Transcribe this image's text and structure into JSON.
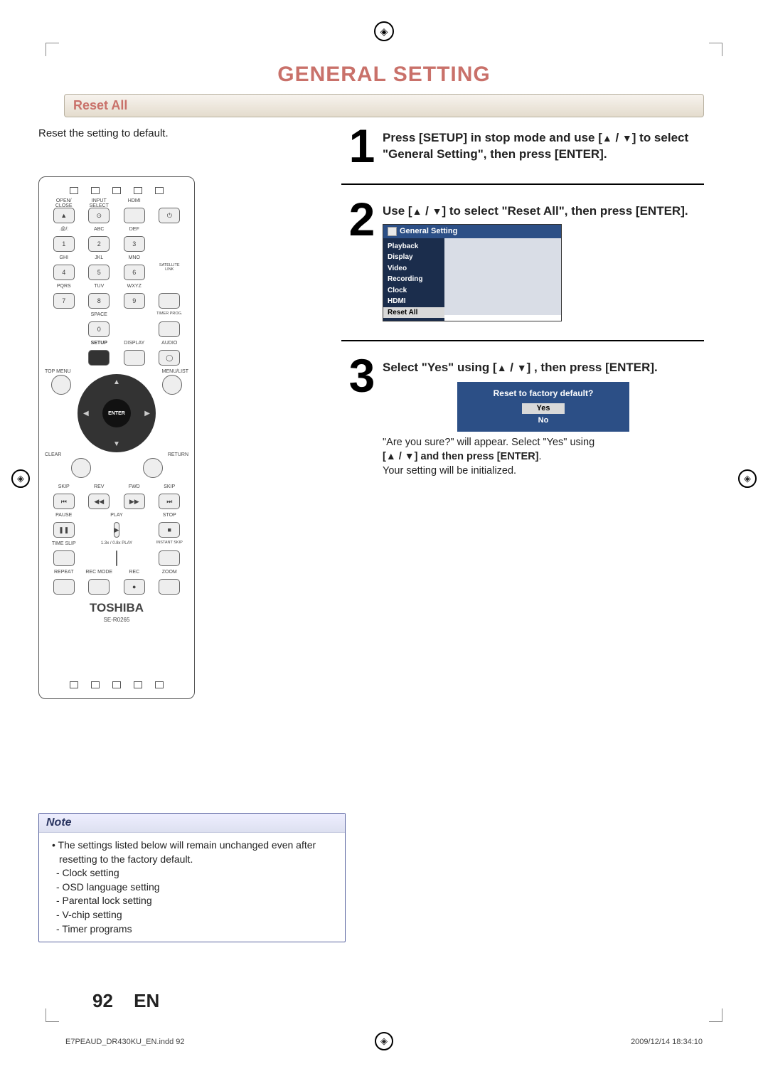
{
  "title": "GENERAL SETTING",
  "section_bar": "Reset All",
  "intro": "Reset the setting to default.",
  "steps": {
    "s1": {
      "num": "1",
      "text_a": "Press [SETUP] in stop mode and use [",
      "text_b": " / ",
      "text_c": "] to select \"General Setting\", then press [ENTER]."
    },
    "s2": {
      "num": "2",
      "text_a": "Use [",
      "text_b": " / ",
      "text_c": "] to select \"Reset All\", then press [ENTER].",
      "osd_title": "General Setting",
      "menu": [
        "Playback",
        "Display",
        "Video",
        "Recording",
        "Clock",
        "HDMI",
        "Reset All"
      ]
    },
    "s3": {
      "num": "3",
      "text_a": "Select \"Yes\" using [",
      "text_b": " / ",
      "text_c": "] , then press [ENTER].",
      "confirm_title": "Reset to factory default?",
      "yes": "Yes",
      "no": "No",
      "after_a": "\"Are you sure?\" will appear. Select \"Yes\" using",
      "after_b": "[",
      "after_c": " / ",
      "after_d": "] and then press ",
      "after_e": "[ENTER]",
      "after_f": ".",
      "after2": "Your setting will be initialized."
    }
  },
  "remote": {
    "row1": [
      "OPEN/\nCLOSE",
      "INPUT\nSELECT",
      "HDMI",
      ""
    ],
    "row2": [
      ".@/:",
      "ABC",
      "DEF",
      ""
    ],
    "nums": [
      "1",
      "2",
      "3",
      "4",
      "5",
      "6",
      "7",
      "8",
      "9",
      "",
      "0",
      ""
    ],
    "row2b": [
      "GHI",
      "JKL",
      "MNO",
      "",
      "PQRS",
      "TUV",
      "WXYZ",
      "SATELLITE\nLINK",
      "",
      "SPACE",
      "",
      "TIMER\nPROG."
    ],
    "row3": [
      "",
      "SETUP",
      "DISPLAY",
      "AUDIO"
    ],
    "top_menu": "TOP MENU",
    "menu_list": "MENU/LIST",
    "enter": "ENTER",
    "clear": "CLEAR",
    "return": "RETURN",
    "trans_labels": [
      "SKIP",
      "REV",
      "FWD",
      "SKIP",
      "PAUSE",
      "PLAY",
      "",
      "STOP",
      "TIME SLIP",
      "1.3x / 0.8x PLAY",
      "",
      "INSTANT SKIP",
      "REPEAT",
      "REC MODE",
      "REC",
      "ZOOM"
    ],
    "brand": "TOSHIBA",
    "model": "SE-R0265",
    "power": "⏻"
  },
  "note": {
    "title": "Note",
    "lead": "The settings listed below will remain unchanged even after resetting to the factory default.",
    "items": [
      "- Clock setting",
      "- OSD language setting",
      "- Parental lock setting",
      "- V-chip setting",
      "- Timer programs"
    ]
  },
  "footer": {
    "page": "92",
    "lang": "EN"
  },
  "fine": {
    "left": "E7PEAUD_DR430KU_EN.indd   92",
    "right": "2009/12/14   18:34:10"
  },
  "glyph": {
    "up": "▲",
    "down": "▼"
  }
}
